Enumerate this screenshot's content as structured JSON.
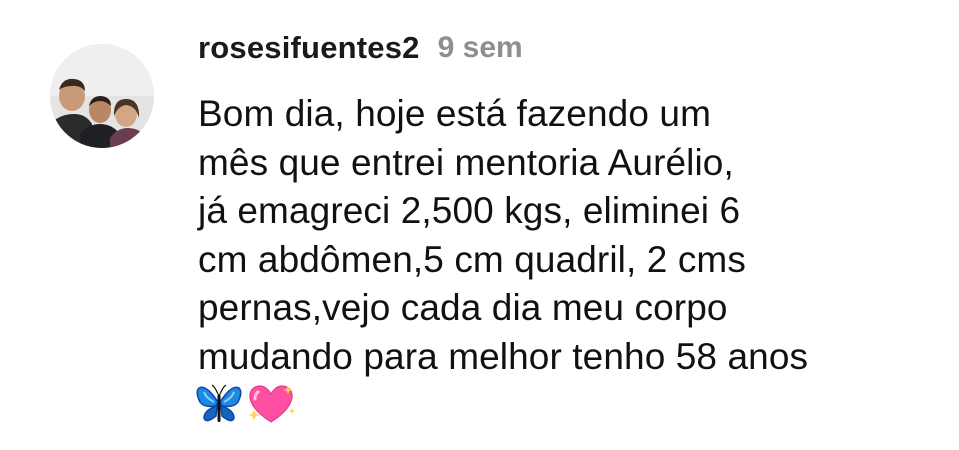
{
  "comment": {
    "username": "rosesifuentes2",
    "timestamp": "9 sem",
    "avatar_icon": "profile-photo-three-people",
    "text_lines": [
      "Bom dia, hoje está fazendo um",
      "mês que entrei mentoria Aurélio,",
      "já emagreci 2,500 kgs, eliminei 6",
      "cm abdômen,5 cm quadril, 2 cms",
      "pernas,vejo cada dia meu corpo",
      "mudando para melhor tenho 58 anos"
    ],
    "emojis": [
      "blue-butterfly-emoji",
      "sparkling-heart-emoji"
    ]
  },
  "colors": {
    "background": "#ffffff",
    "text": "#111111",
    "timestamp": "#8e8e8e",
    "butterfly": "#1e88e5",
    "heart": "#ff4fa3"
  }
}
